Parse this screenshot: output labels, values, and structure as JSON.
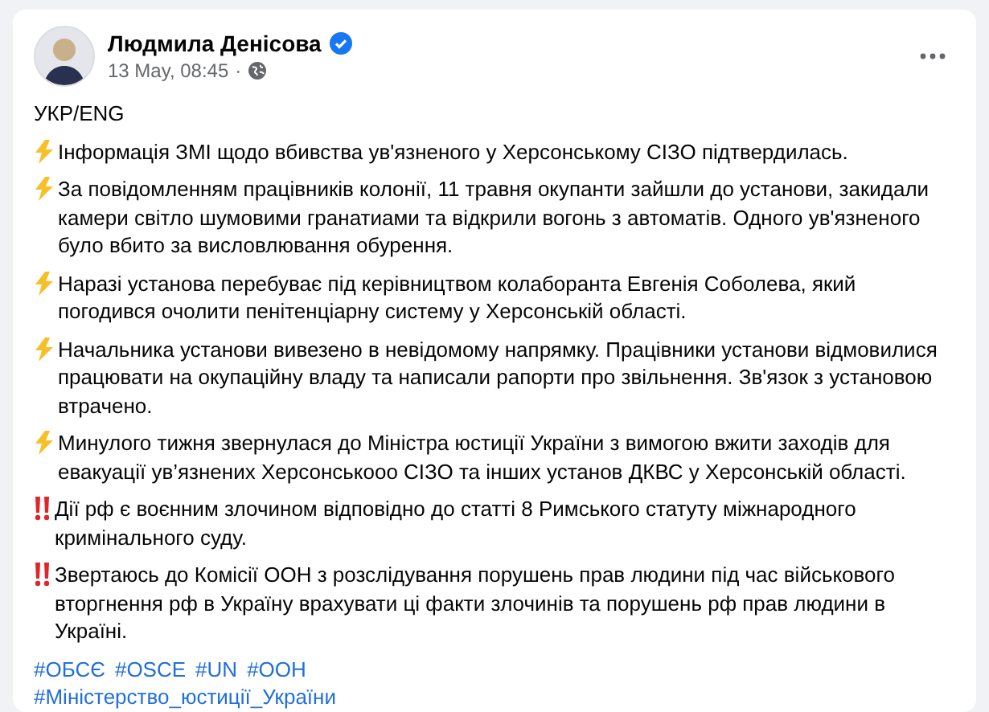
{
  "post": {
    "author": "Людмила Денісова",
    "verified": true,
    "time": "13 May, 08:45",
    "separator": "·",
    "public": true
  },
  "paragraphs": [
    {
      "kind": "plain",
      "text": "УКР/ENG"
    },
    {
      "kind": "lightning",
      "text": "Інформація ЗМІ щодо вбивства ув'язненого у Херсонському СІЗО підтвердилась."
    },
    {
      "kind": "lightning",
      "text": "За повідомленням працівників колонії, 11 травня  окупанти зайшли до установи, закидали камери світло шумовими гранатиами та відкрили вогонь з автоматів. Одного ув'язненого було вбито за висловлювання обурення."
    },
    {
      "kind": "lightning",
      "text": "Наразі установа перебуває під керівництвом колаборанта Евгенія Соболева, який погодився очолити пенітенціарну систему у Херсонській області."
    },
    {
      "kind": "lightning",
      "text": "Начальника установи вивезено в невідомому напрямку. Працівники установи відмовилися працювати на окупаційну владу та  написали рапорти про звільнення. Зв'язок з установою втрачено."
    },
    {
      "kind": "lightning",
      "text": "Минулого тижня  звернулася до Міністра юстиції України з вимогою вжити заходів для евакуації ув’язнених Херсонськооо СІЗО та інших установ ДКВС у Херсонській області."
    },
    {
      "kind": "alert",
      "text": "Дії рф є воєнним злочином відповідно до статті 8 Римського статуту міжнародного кримінального суду."
    },
    {
      "kind": "alert",
      "text": "Звертаюсь до Комісії ООН з розслідування порушень прав людини під час військового вторгнення рф в Україну врахувати ці факти злочинів та порушень рф прав людини в Україні."
    }
  ],
  "hashtag_lines": [
    [
      "#ОБСЄ",
      "#OSCE",
      "#UN",
      "#ООН"
    ],
    [
      "#Міністерство_юстиції_України"
    ]
  ]
}
